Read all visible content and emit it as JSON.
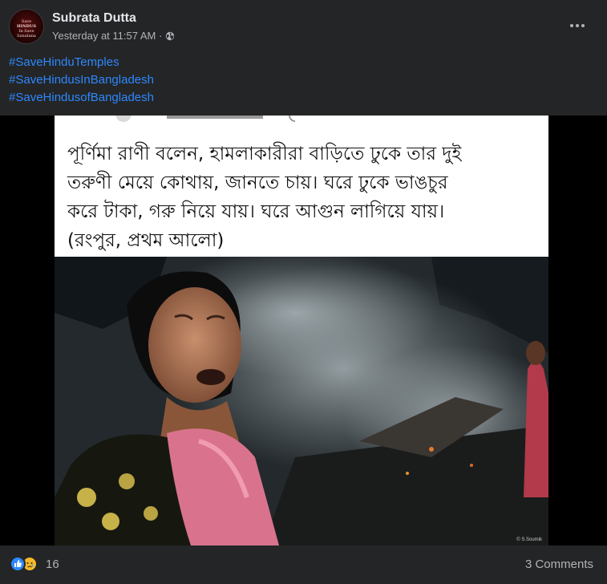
{
  "post": {
    "author": "Subrata Dutta",
    "timestamp": "Yesterday at 11:57 AM · ",
    "privacy_icon": "globe-icon",
    "avatar_text": [
      "Save",
      "HINDUS",
      "In Save",
      "Sanatana"
    ],
    "hashtags": [
      "#SaveHinduTemples",
      "#SaveHindusInBangladesh",
      "#SaveHindusofBangladesh"
    ]
  },
  "image": {
    "caption_lines": [
      "পূর্ণিমা রাণী বলেন, হামলাকারীরা বাড়িতে ঢুকে তার দুই",
      "তরুণী মেয়ে কোথায়, জানতে চায়। ঘরে ঢুকে ভাঙচুর",
      "করে টাকা, গরু নিয়ে যায়। ঘরে আগুন লাগিয়ে যায়।",
      "(রংপুর, প্রথম আলো)"
    ],
    "watermark": "© S.Soumik"
  },
  "footer": {
    "reaction_count": "16",
    "reaction_icons": [
      "like-icon",
      "sad-icon"
    ],
    "comments": "3 Comments"
  },
  "colors": {
    "background": "#242526",
    "link": "#2d88ff",
    "secondary_text": "#b0b3b8"
  }
}
